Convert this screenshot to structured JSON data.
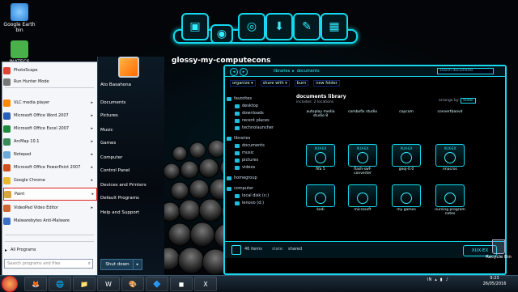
{
  "desktop": {
    "icons": [
      {
        "label": "Google Earth",
        "label2": "bin",
        "color": "#2a7fd4"
      },
      {
        "label": "INATECS",
        "label2": "",
        "color": "#4ab04a"
      }
    ],
    "recycle_bin": "Recycle Bin"
  },
  "dock": {
    "label": "glossy-my-computecons"
  },
  "start_menu": {
    "programs": [
      {
        "label": "PhotoScape",
        "color": "#d43",
        "arrow": false
      },
      {
        "label": "Run Hunter Mode",
        "color": "#777",
        "arrow": false
      },
      {
        "label": "VLC media player",
        "color": "#f80",
        "arrow": true
      },
      {
        "label": "Microsoft Office Word 2007",
        "color": "#2b5fb5",
        "arrow": true
      },
      {
        "label": "Microsoft Office Excel 2007",
        "color": "#1f8a3c",
        "arrow": true
      },
      {
        "label": "ArcMap 10.1",
        "color": "#3a8a5a",
        "arrow": true
      },
      {
        "label": "Notepad",
        "color": "#6aa8d8",
        "arrow": true
      },
      {
        "label": "Microsoft Office PowerPoint 2007",
        "color": "#d2501e",
        "arrow": true
      },
      {
        "label": "Google Chrome",
        "color": "#e8b92a",
        "arrow": true
      },
      {
        "label": "Paint",
        "color": "#d9a437",
        "arrow": true
      },
      {
        "label": "VideoPad Video Editor",
        "color": "#c63",
        "arrow": true
      },
      {
        "label": "Malwarebytes Anti-Malware",
        "color": "#3a6fc4",
        "arrow": false
      }
    ],
    "all_programs": "All Programs",
    "search_placeholder": "Search programs and files",
    "right_items": [
      {
        "label": "Ato Basahona",
        "arrow": false
      },
      {
        "label": "Documents",
        "arrow": false
      },
      {
        "label": "Pictures",
        "arrow": false
      },
      {
        "label": "Music",
        "arrow": false
      },
      {
        "label": "Games",
        "arrow": false
      },
      {
        "label": "Computer",
        "arrow": false
      },
      {
        "label": "Control Panel",
        "arrow": false
      },
      {
        "label": "Devices and Printers",
        "arrow": false
      },
      {
        "label": "Default Programs",
        "arrow": false
      },
      {
        "label": "Help and Support",
        "arrow": false
      }
    ],
    "shutdown": "Shut down",
    "shutdown_arrow": "▸"
  },
  "explorer": {
    "breadcrumb": [
      "libraries",
      "documents"
    ],
    "search_placeholder": "search documents",
    "toolbar": [
      "organize ▾",
      "share with ▾",
      "burn",
      "new folder"
    ],
    "tree": [
      {
        "label": "favorites",
        "indent": 0
      },
      {
        "label": "desktop",
        "indent": 1
      },
      {
        "label": "downloads",
        "indent": 1
      },
      {
        "label": "recent places",
        "indent": 1
      },
      {
        "label": "technolauncher",
        "indent": 1
      },
      {
        "label": "libraries",
        "indent": 0
      },
      {
        "label": "documents",
        "indent": 1
      },
      {
        "label": "music",
        "indent": 1
      },
      {
        "label": "pictures",
        "indent": 1
      },
      {
        "label": "videos",
        "indent": 1
      },
      {
        "label": "homegroup",
        "indent": 0
      },
      {
        "label": "computer",
        "indent": 0
      },
      {
        "label": "local disk (c:)",
        "indent": 1
      },
      {
        "label": "lenovo (d:)",
        "indent": 1
      }
    ],
    "library_title": "documents library",
    "library_sub": "includes: 2 locations",
    "arrange_label": "arrange by:",
    "arrange_value": "folder",
    "files_top": [
      "autoplay media studio 8",
      "combofix studio",
      "copcom",
      "convertbaovd"
    ],
    "files": [
      {
        "label": "fifa 5",
        "thumb": "XUX-EX"
      },
      {
        "label": "flash-swf-converter",
        "thumb": "XUX-EX"
      },
      {
        "label": "geoj-0.0",
        "thumb": "XUX-EX"
      },
      {
        "label": "imacros",
        "thumb": "XUX-EX"
      },
      {
        "label": "kodi",
        "thumb": ""
      },
      {
        "label": "microsoft",
        "thumb": ""
      },
      {
        "label": "my games",
        "thumb": ""
      },
      {
        "label": "nursing program notes",
        "thumb": ""
      }
    ],
    "status_count": "46 items",
    "status_state_label": "state:",
    "status_state_value": "shared",
    "badge": "XUX-EX"
  },
  "taskbar": {
    "buttons": [
      "🦊",
      "🌐",
      "📁",
      "W",
      "🎨",
      "🔷",
      "◼",
      "X"
    ],
    "tray_lang": "IN",
    "time": "9:23",
    "date": "26/05/2016"
  },
  "colors": {
    "accent": "#16d8ee",
    "selected_border": "#e02020"
  }
}
